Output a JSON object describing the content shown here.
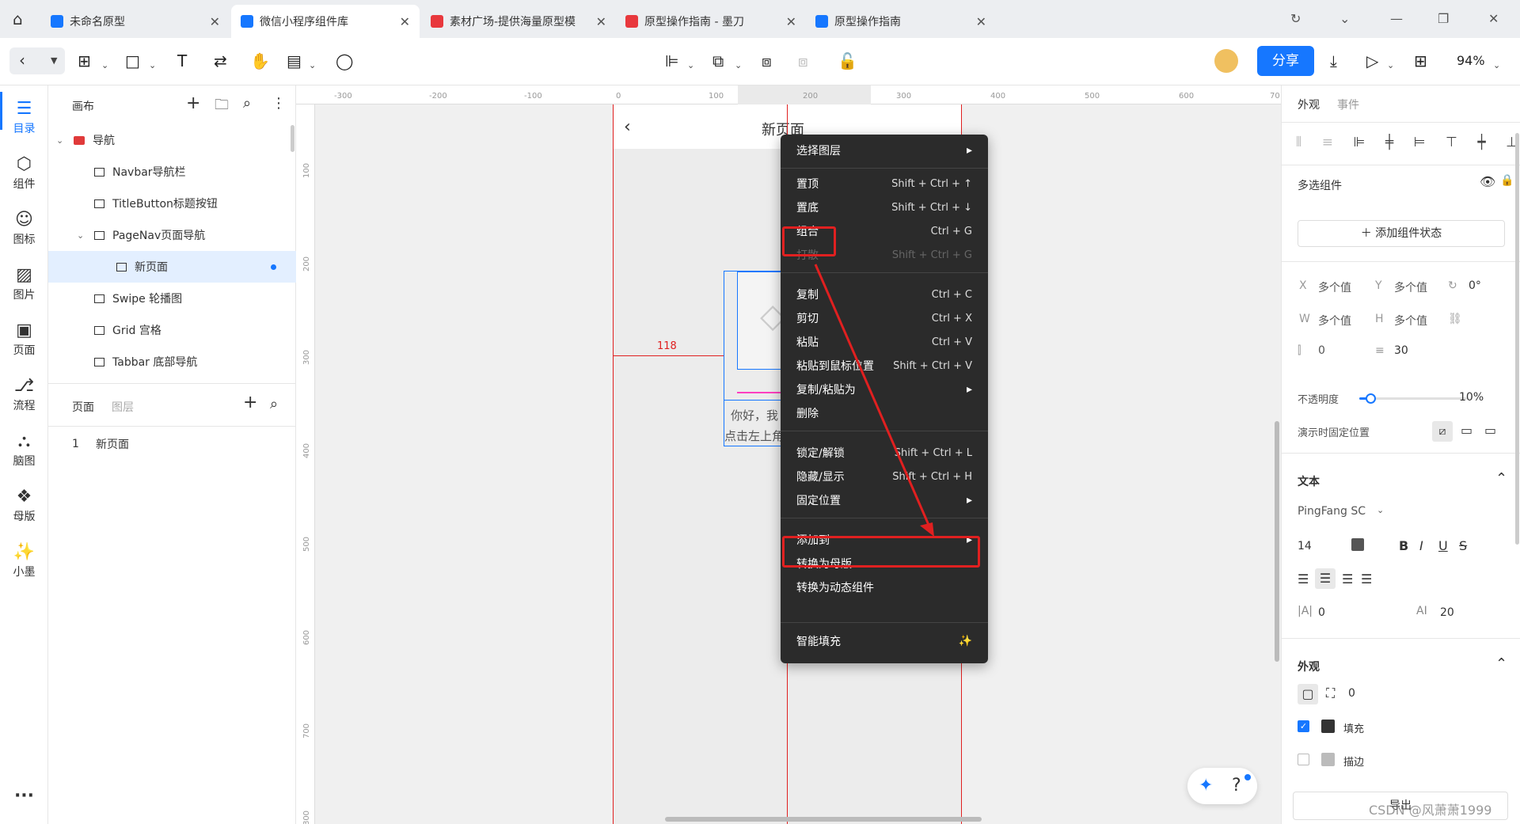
{
  "tabs": [
    {
      "label": "未命名原型",
      "active": false
    },
    {
      "label": "微信小程序组件库",
      "active": true
    },
    {
      "label": "素材广场-提供海量原型模",
      "active": false
    },
    {
      "label": "原型操作指南 - 墨刀",
      "active": false
    },
    {
      "label": "原型操作指南",
      "active": false
    }
  ],
  "toolbar": {
    "share": "分享",
    "zoom": "94%"
  },
  "leftnav": [
    {
      "label": "目录",
      "icon": "list-icon"
    },
    {
      "label": "组件",
      "icon": "cube-icon"
    },
    {
      "label": "图标",
      "icon": "smiley-icon"
    },
    {
      "label": "图片",
      "icon": "image-icon"
    },
    {
      "label": "页面",
      "icon": "page-icon"
    },
    {
      "label": "流程",
      "icon": "flow-icon"
    },
    {
      "label": "脑图",
      "icon": "mindmap-icon"
    },
    {
      "label": "母版",
      "icon": "master-icon"
    },
    {
      "label": "小墨",
      "icon": "magic-wand-icon"
    },
    {
      "label": "···",
      "icon": "more-icon"
    }
  ],
  "layers": {
    "title": "画布",
    "items": [
      {
        "label": "导航",
        "level": 0
      },
      {
        "label": "Navbar导航栏",
        "level": 1
      },
      {
        "label": "TitleButton标题按钮",
        "level": 1
      },
      {
        "label": "PageNav页面导航",
        "level": 1
      },
      {
        "label": "新页面",
        "level": 2
      },
      {
        "label": "Swipe 轮播图",
        "level": 1
      },
      {
        "label": "Grid 宫格",
        "level": 1
      },
      {
        "label": "Tabbar 底部导航",
        "level": 1
      }
    ],
    "pages_tab": "页面",
    "layers_tab": "图层",
    "page_list": [
      {
        "index": "1",
        "label": "新页面"
      }
    ]
  },
  "canvas": {
    "ruler_h": [
      "-300",
      "-200",
      "-100",
      "0",
      "100",
      "200",
      "300",
      "400",
      "500",
      "600",
      "70"
    ],
    "ruler_v": [
      "100",
      "200",
      "300",
      "400",
      "500",
      "600",
      "700",
      "800"
    ],
    "page_title": "新页面",
    "measure": "118",
    "text1": "你好，我",
    "text2": "点击左上角"
  },
  "context_menu": {
    "items": [
      {
        "label": "选择图层",
        "shortcut": "",
        "submenu": true,
        "disabled": false
      },
      {
        "label": "置顶",
        "shortcut": "Shift + Ctrl + ↑",
        "submenu": false,
        "disabled": false
      },
      {
        "label": "置底",
        "shortcut": "Shift + Ctrl + ↓",
        "submenu": false,
        "disabled": false
      },
      {
        "label": "组合",
        "shortcut": "Ctrl + G",
        "submenu": false,
        "disabled": false
      },
      {
        "label": "打散",
        "shortcut": "Shift + Ctrl + G",
        "submenu": false,
        "disabled": true
      },
      {
        "label": "复制",
        "shortcut": "Ctrl + C",
        "submenu": false,
        "disabled": false
      },
      {
        "label": "剪切",
        "shortcut": "Ctrl + X",
        "submenu": false,
        "disabled": false
      },
      {
        "label": "粘贴",
        "shortcut": "Ctrl + V",
        "submenu": false,
        "disabled": false
      },
      {
        "label": "粘贴到鼠标位置",
        "shortcut": "Shift + Ctrl + V",
        "submenu": false,
        "disabled": false
      },
      {
        "label": "复制/粘贴为",
        "shortcut": "",
        "submenu": true,
        "disabled": false
      },
      {
        "label": "删除",
        "shortcut": "",
        "submenu": false,
        "disabled": false
      },
      {
        "label": "锁定/解锁",
        "shortcut": "Shift + Ctrl + L",
        "submenu": false,
        "disabled": false
      },
      {
        "label": "隐藏/显示",
        "shortcut": "Shift + Ctrl + H",
        "submenu": false,
        "disabled": false
      },
      {
        "label": "固定位置",
        "shortcut": "",
        "submenu": true,
        "disabled": false
      },
      {
        "label": "添加到",
        "shortcut": "",
        "submenu": true,
        "disabled": false
      },
      {
        "label": "转换为母版",
        "shortcut": "",
        "submenu": false,
        "disabled": false
      },
      {
        "label": "转换为动态组件",
        "shortcut": "",
        "submenu": false,
        "disabled": false
      },
      {
        "label": "智能填充",
        "shortcut": "",
        "submenu": false,
        "disabled": false
      }
    ]
  },
  "right_panel": {
    "tab_appearance": "外观",
    "tab_events": "事件",
    "multi_select": "多选组件",
    "add_state": "添加组件状态",
    "x_label": "X",
    "x_value": "多个值",
    "y_label": "Y",
    "y_value": "多个值",
    "rot_value": "0°",
    "w_label": "W",
    "w_value": "多个值",
    "h_label": "H",
    "h_value": "多个值",
    "spacing1": "0",
    "spacing2": "30",
    "opacity_label": "不透明度",
    "opacity_value": "10%",
    "fixed_label": "演示时固定位置",
    "text_section": "文本",
    "font": "PingFang SC",
    "font_size": "14",
    "letter_spacing": "0",
    "line_height": "20",
    "appearance_section": "外观",
    "radius": "0",
    "fill_label": "填充",
    "stroke_label": "描边",
    "export_label": "导出",
    "watermark": "CSDN @风萧萧1999"
  },
  "colors": {
    "accent": "#1677ff",
    "menu_bg": "#2b2b2b",
    "highlight": "#e02020"
  }
}
